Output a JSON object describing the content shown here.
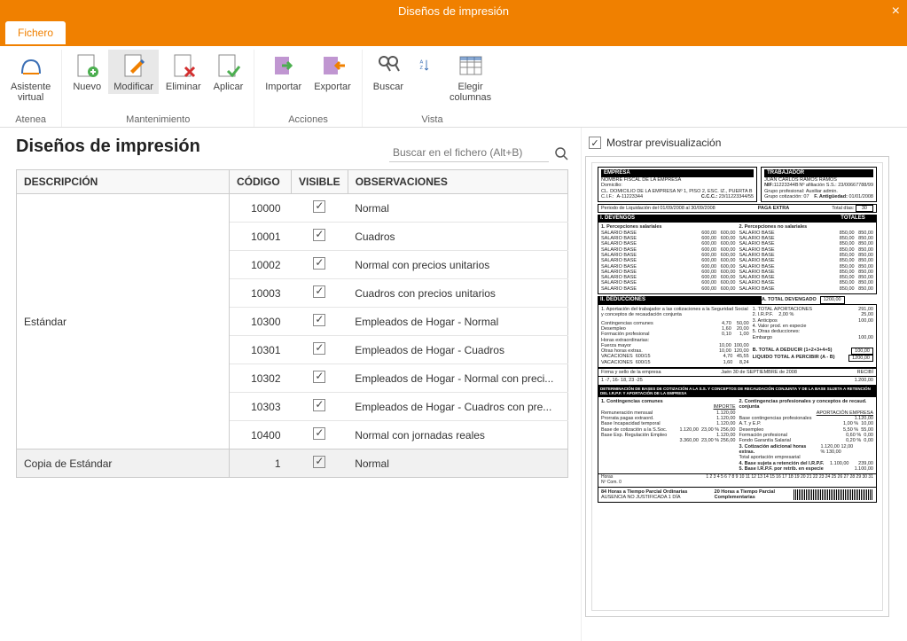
{
  "window": {
    "title": "Diseños de impresión",
    "close": "×"
  },
  "ribbon": {
    "tab": "Fichero",
    "groups": [
      {
        "label": "Atenea",
        "buttons": [
          {
            "key": "asistente",
            "label": "Asistente\nvirtual"
          }
        ]
      },
      {
        "label": "Mantenimiento",
        "buttons": [
          {
            "key": "nuevo",
            "label": "Nuevo"
          },
          {
            "key": "modificar",
            "label": "Modificar"
          },
          {
            "key": "eliminar",
            "label": "Eliminar"
          },
          {
            "key": "aplicar",
            "label": "Aplicar"
          }
        ]
      },
      {
        "label": "Acciones",
        "buttons": [
          {
            "key": "importar",
            "label": "Importar"
          },
          {
            "key": "exportar",
            "label": "Exportar"
          }
        ]
      },
      {
        "label": "Vista",
        "buttons": [
          {
            "key": "buscar",
            "label": "Buscar"
          },
          {
            "key": "sort",
            "label": ""
          },
          {
            "key": "columnas",
            "label": "Elegir\ncolumnas"
          }
        ]
      }
    ]
  },
  "page": {
    "heading": "Diseños de impresión",
    "search_placeholder": "Buscar en el fichero (Alt+B)",
    "preview_label": "Mostrar previsualización",
    "columns": {
      "desc": "DESCRIPCIÓN",
      "code": "CÓDIGO",
      "visible": "VISIBLE",
      "obs": "OBSERVACIONES"
    }
  },
  "rows_estandar": {
    "group_label": "Estándar",
    "items": [
      {
        "code": "10000",
        "obs": "Normal"
      },
      {
        "code": "10001",
        "obs": "Cuadros"
      },
      {
        "code": "10002",
        "obs": "Normal con precios unitarios"
      },
      {
        "code": "10003",
        "obs": "Cuadros con precios unitarios"
      },
      {
        "code": "10300",
        "obs": "Empleados de Hogar - Normal"
      },
      {
        "code": "10301",
        "obs": "Empleados de Hogar - Cuadros"
      },
      {
        "code": "10302",
        "obs": "Empleados de Hogar - Normal con preci..."
      },
      {
        "code": "10303",
        "obs": "Empleados de Hogar - Cuadros con pre..."
      },
      {
        "code": "10400",
        "obs": "Normal con jornadas reales"
      }
    ]
  },
  "rows_copy": {
    "group_label": "Copia de Estándar",
    "items": [
      {
        "code": "1",
        "obs": "Normal"
      }
    ]
  },
  "preview_doc": {
    "empresa_title": "EMPRESA",
    "empresa_name": "NOMBRE FISCAL DE LA EMPRESA",
    "empresa_dom_lbl": "Domicilio:",
    "empresa_dom": "CL. DOMICILIO DE LA EMPRESA Nº 1, PISO 2, ESC. IZ., PUERTA B",
    "empresa_cif_lbl": "C.I.F.:",
    "empresa_cif": "A-11223344",
    "empresa_ccc_lbl": "C.C.C.:",
    "empresa_ccc": "23/11223344/55",
    "trab_title": "TRABAJADOR",
    "trab_name": "JUAN CARLOS RAMOS RAMOS",
    "trab_nif_lbl": "NIF:",
    "trab_nif": "11223344B",
    "trab_afil_lbl": "Nº afiliación S.S.:",
    "trab_afil": "23/00667788/99",
    "trab_grp_lbl": "Grupo profesional:",
    "trab_grp": "Auxiliar admin.",
    "trab_cot_lbl": "Grupo cotización:",
    "trab_cot": "07",
    "trab_ant_lbl": "F. Antigüedad:",
    "trab_ant": "01/01/2008",
    "periodo": "Periodo de Liquidación del  01/09/2008    al   30/09/2008",
    "paga": "PAGA EXTRA",
    "totdias_lbl": "Total días:",
    "totdias": "30",
    "devengos": "I.  DEVENGOS",
    "totales": "TOTALES",
    "perc1": "1. Percepciones salariales",
    "perc2": "2. Percepciones no salariales",
    "salbase": "SALARIO BASE",
    "salbase_v1": "600,00",
    "salbase_v2": "850,00",
    "deducciones": "II.  DEDUCCIONES",
    "tot_devengado_lbl": "A.  TOTAL DEVENGADO",
    "tot_devengado": "1200,00",
    "aport_sec": "1. Aportación del trabajador a las cotizaciones a la Seguridad Social y conceptos de recaudación conjunta",
    "tot_aport_lbl": "1.   TOTAL APORTACIONES",
    "tot_aport": "291,00",
    "irpf_lbl": "2.   I.R.P.F.",
    "irpf_pct": "2,00   %",
    "irpf_val": "25,00",
    "anticipos_lbl": "3.   Anticipos",
    "anticipos": "100,00",
    "valesp_lbl": "4.   Valor prod. en especie",
    "otrasded_lbl": "5.   Otras deducciones:",
    "embargo_lbl": "Embargo",
    "embargo": "100,00",
    "cc_lbl": "Contingencias comunes",
    "cc_pct": "4,70",
    "cc_val": "50,00",
    "des_lbl": "Desempleo",
    "des_pct": "1,60",
    "des_val": "20,00",
    "fp_lbl": "Formación profesional",
    "fp_pct": "0,10",
    "fp_val": "1,00",
    "he_lbl": "Horas extraordinarias:",
    "fm_lbl": "Fuerza mayor",
    "fm_pct": "10,00",
    "fm_val": "100,00",
    "oh_lbl": "Otras horas extras.",
    "oh_pct": "10,00",
    "oh_val": "120,00",
    "vac1_lbl": "VACACIONES",
    "vac1_a": "600/15",
    "vac1_b": "4,70",
    "vac1_c": "45,55",
    "vac2_lbl": "VACACIONES",
    "vac2_a": "600/15",
    "vac2_b": "1,60",
    "vac2_c": "8,24",
    "tot_deducir_lbl": "B.  TOTAL A DEDUCIR (1+2+3+4+5)",
    "tot_deducir": "100,00",
    "liquido_lbl": "LIQUIDO TOTAL A PERCIBIR (A - B)",
    "liquido": "1200,00",
    "firma_lbl": "Firma y sello de la empresa",
    "fecha": "Jaén  30     de  SEPTIEMBRE    de    2008",
    "recibi": "RECIBÍ",
    "dias_line": "1 -7,  16- 18,  23 -25",
    "dias_val": "1.200,00",
    "bases_title": "DETERMINACIÓN DE BASES DE COTIZACIÓN A LA S.S. Y CONCEPTOS DE RECAUDACIÓN CONJUNTA Y DE LA BASE SUJETA A RETENCIÓN DEL I.R.P.F. Y APORTACIÓN DE LA EMPRESA",
    "bases1": "1. Contingencias comunes",
    "bases_importe": "IMPORTE",
    "aport_emp": "APORTACIÓN EMPRESA",
    "rem_lbl": "Remuneración mensual",
    "rem_v": "1.120,00",
    "pp_lbl": "Prorrata pagas extraord.",
    "pp_v": "1.120,00",
    "bit_lbl": "Base Incapacidad temporal",
    "bit_v": "1.120,00",
    "bss_lbl": "Base de cotización a la S.Soc.",
    "bss_v": "1.120,00",
    "bss_p": "23,00 %",
    "bss_t": "256,00",
    "bre_lbl": "Base Exp. Regulación Empleo",
    "bre_v": "1.120,00",
    "tot_bc": "3.360,00",
    "tot_bc_p": "23,00 %",
    "tot_bc_t": "256,00",
    "bases2": "2. Contingencias profesionales y conceptos de recaud. conjunta",
    "bcp_lbl": "Base contingencias profesionales",
    "bcp_v": "1.120,00",
    "atyep_lbl": "A.T. y E.P.",
    "atyep_p": "1,00 %",
    "atyep_t": "10,00",
    "des2_lbl": "Desempleo",
    "des2_p": "5,50 %",
    "des2_t": "55,00",
    "fp2_lbl": "Formación profesional",
    "fp2_p": "0,60 %",
    "fp2_t": "0,00",
    "fgs_lbl": "Fondo Garantía Salarial",
    "fgs_p": "0,20 %",
    "fgs_t": "0,00",
    "cah_lbl": "3. Cotización adicional horas  extras.",
    "cah_v": "1.120,00",
    "cah_p": "12,00 %",
    "cah_t": "130,00",
    "tae_lbl": "Total aportación empresarial",
    "birpf_lbl": "4. Base sujeta a retención del I.R.P.F.",
    "birpf_v": "1.100,00",
    "birpf_t": "239,00",
    "birpfe_lbl": "5. Base I.R.P.F. por retrib. en especie",
    "birpfe_v": "1.100,00",
    "foot1": "84 Horas a Tiempo Parcial Ordinarias",
    "foot2": "20 Horas a Tiempo Parcial Complementarias",
    "foot3": "AUSENCIA NO JUSTIFICADA 1 DÍA",
    "horas_lbl": "Horas",
    "ncom_lbl": "Nº Com."
  }
}
